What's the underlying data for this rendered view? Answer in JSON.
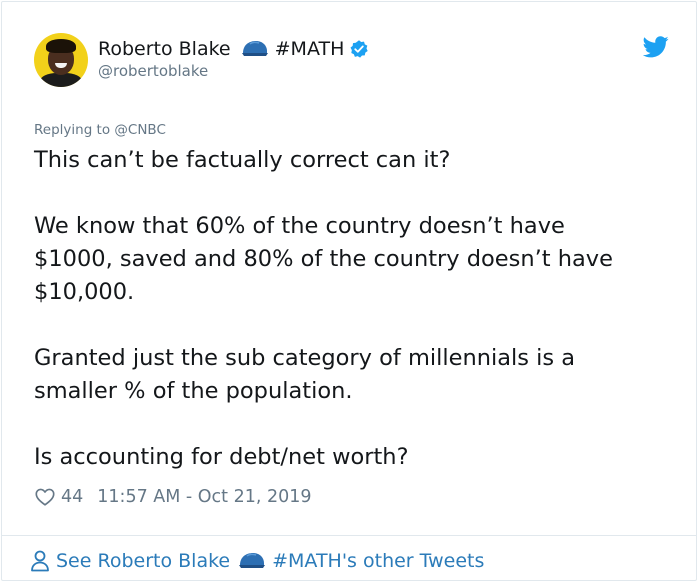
{
  "user": {
    "display_name": "Roberto Blake",
    "name_suffix": "#MATH",
    "handle": "@robertoblake"
  },
  "tweet": {
    "replying_to": "Replying to @CNBC",
    "paragraphs": [
      [
        "This can’t be factually correct can it?"
      ],
      [
        "We know that 60% of the country doesn’t have",
        "$1000, saved and 80% of the country doesn’t have",
        "$10,000."
      ],
      [
        "Granted just the sub category of millennials is a",
        "smaller % of the population."
      ],
      [
        "Is accounting for debt/net worth?"
      ]
    ],
    "like_count": "44",
    "timestamp": "11:57 AM - Oct 21, 2019"
  },
  "footer": {
    "prefix": "See Roberto Blake",
    "suffix": "#MATH's other Tweets"
  },
  "icons": {
    "avatar": "avatar",
    "cap": "graduation-cap-icon",
    "verified": "verified-badge-icon",
    "brand": "twitter-bird-icon",
    "like": "heart-icon",
    "profile": "person-icon"
  },
  "colors": {
    "verified": "#1da1f2",
    "brand": "#1da1f2",
    "link": "#2b7bb9",
    "muted": "#657786",
    "cap": "#2d6fb3"
  }
}
